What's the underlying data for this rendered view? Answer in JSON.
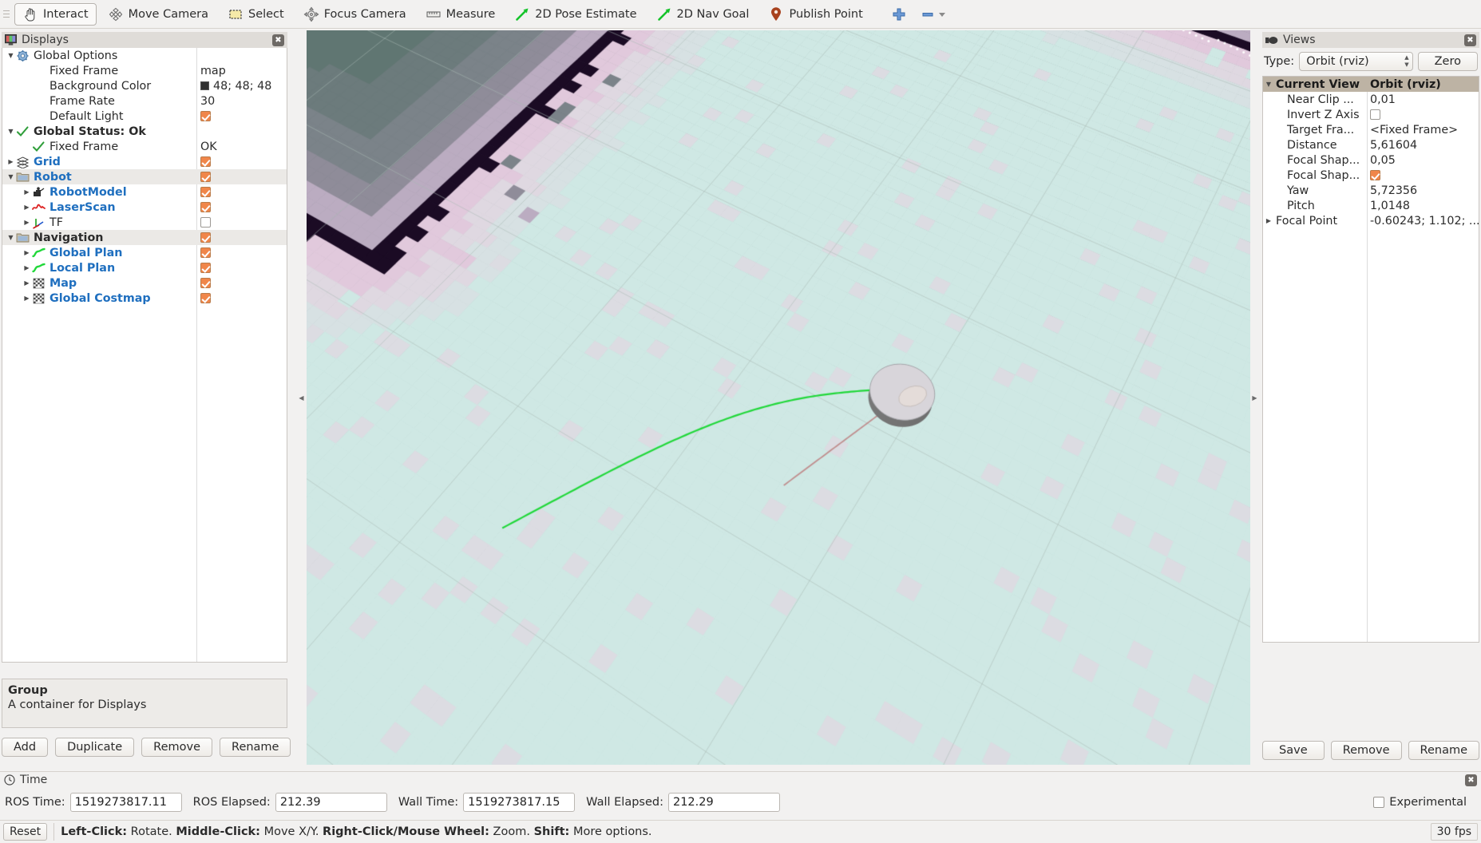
{
  "toolbar": {
    "items": [
      {
        "label": "Interact",
        "icon": "hand-cursor-icon",
        "active": true
      },
      {
        "label": "Move Camera",
        "icon": "move-camera-icon",
        "active": false
      },
      {
        "label": "Select",
        "icon": "select-rectangle-icon",
        "active": false
      },
      {
        "label": "Focus Camera",
        "icon": "focus-camera-icon",
        "active": false
      },
      {
        "label": "Measure",
        "icon": "ruler-icon",
        "active": false
      },
      {
        "label": "2D Pose Estimate",
        "icon": "green-arrow-icon",
        "active": false
      },
      {
        "label": "2D Nav Goal",
        "icon": "green-arrow-icon",
        "active": false
      },
      {
        "label": "Publish Point",
        "icon": "map-pin-icon",
        "active": false
      }
    ],
    "add_tool_icon": "plus-icon",
    "remove_tool_icon": "minus-icon",
    "remove_tool_caret": "chevron-down-icon"
  },
  "displays": {
    "title": "Displays",
    "close_icon": "close-icon",
    "panel_icon": "display-monitor-icon",
    "rows": [
      {
        "indent": 0,
        "arrow": "down",
        "icon": "gear-icon",
        "label": "Global Options",
        "style": "plain",
        "value_type": "none"
      },
      {
        "indent": 1,
        "arrow": "none",
        "icon": "none",
        "label": "Fixed Frame",
        "style": "plain",
        "value_type": "text",
        "value": "map"
      },
      {
        "indent": 1,
        "arrow": "none",
        "icon": "none",
        "label": "Background Color",
        "style": "plain",
        "value_type": "color",
        "value": "48; 48; 48",
        "color": "#303030"
      },
      {
        "indent": 1,
        "arrow": "none",
        "icon": "none",
        "label": "Frame Rate",
        "style": "plain",
        "value_type": "text",
        "value": "30"
      },
      {
        "indent": 1,
        "arrow": "none",
        "icon": "none",
        "label": "Default Light",
        "style": "plain",
        "value_type": "check",
        "checked": true
      },
      {
        "indent": 0,
        "arrow": "down",
        "icon": "check-icon",
        "label": "Global Status: Ok",
        "style": "bold",
        "value_type": "none"
      },
      {
        "indent": 1,
        "arrow": "none",
        "icon": "check-icon",
        "label": "Fixed Frame",
        "style": "plain",
        "value_type": "text",
        "value": "OK"
      },
      {
        "indent": 0,
        "arrow": "right",
        "icon": "grid-icon",
        "label": "Grid",
        "style": "blue",
        "value_type": "check",
        "checked": true
      },
      {
        "indent": 0,
        "arrow": "down",
        "icon": "folder-icon",
        "label": "Robot",
        "style": "blue",
        "value_type": "check",
        "checked": true,
        "group": true
      },
      {
        "indent": 1,
        "arrow": "right",
        "icon": "robot-icon",
        "label": "RobotModel",
        "style": "blue",
        "value_type": "check",
        "checked": true
      },
      {
        "indent": 1,
        "arrow": "right",
        "icon": "laserscan-icon",
        "label": "LaserScan",
        "style": "blue",
        "value_type": "check",
        "checked": true
      },
      {
        "indent": 1,
        "arrow": "right",
        "icon": "tf-axes-icon",
        "label": "TF",
        "style": "plain",
        "value_type": "check",
        "checked": false
      },
      {
        "indent": 0,
        "arrow": "down",
        "icon": "folder-icon",
        "label": "Navigation",
        "style": "bold",
        "value_type": "check",
        "checked": true,
        "group": true
      },
      {
        "indent": 1,
        "arrow": "right",
        "icon": "path-icon",
        "label": "Global Plan",
        "style": "blue",
        "value_type": "check",
        "checked": true
      },
      {
        "indent": 1,
        "arrow": "right",
        "icon": "path-icon",
        "label": "Local Plan",
        "style": "blue",
        "value_type": "check",
        "checked": true
      },
      {
        "indent": 1,
        "arrow": "right",
        "icon": "map-grid-icon",
        "label": "Map",
        "style": "blue",
        "value_type": "check",
        "checked": true
      },
      {
        "indent": 1,
        "arrow": "right",
        "icon": "map-grid-icon",
        "label": "Global Costmap",
        "style": "blue",
        "value_type": "check",
        "checked": true
      }
    ],
    "description": {
      "title": "Group",
      "text": "A container for Displays"
    },
    "buttons": [
      "Add",
      "Duplicate",
      "Remove",
      "Rename"
    ]
  },
  "views": {
    "title": "Views",
    "panel_icon": "camera-icon",
    "close_icon": "close-icon",
    "type_label": "Type:",
    "type_value": "Orbit (rviz)",
    "zero_button": "Zero",
    "header": {
      "name": "Current View",
      "value": "Orbit (rviz)"
    },
    "rows": [
      {
        "label": "Near Clip ...",
        "value_type": "text",
        "value": "0,01"
      },
      {
        "label": "Invert Z Axis",
        "value_type": "check",
        "checked": false
      },
      {
        "label": "Target Fra...",
        "value_type": "text",
        "value": "<Fixed Frame>"
      },
      {
        "label": "Distance",
        "value_type": "text",
        "value": "5,61604"
      },
      {
        "label": "Focal Shap...",
        "value_type": "text",
        "value": "0,05"
      },
      {
        "label": "Focal Shap...",
        "value_type": "check",
        "checked": true
      },
      {
        "label": "Yaw",
        "value_type": "text",
        "value": "5,72356"
      },
      {
        "label": "Pitch",
        "value_type": "text",
        "value": "1,0148"
      },
      {
        "label": "Focal Point",
        "value_type": "text",
        "value": "-0.60243; 1.102; ...",
        "arrow": "right"
      }
    ],
    "buttons": [
      "Save",
      "Remove",
      "Rename"
    ]
  },
  "time": {
    "title": "Time",
    "panel_icon": "clock-icon",
    "close_icon": "close-icon",
    "fields": [
      {
        "label": "ROS Time:",
        "value": "1519273817.11"
      },
      {
        "label": "ROS Elapsed:",
        "value": "212.39"
      },
      {
        "label": "Wall Time:",
        "value": "1519273817.15"
      },
      {
        "label": "Wall Elapsed:",
        "value": "212.29"
      }
    ],
    "experimental_label": "Experimental",
    "experimental_checked": false
  },
  "statusbar": {
    "reset_button": "Reset",
    "hint_parts": [
      {
        "text": "Left-Click:",
        "bold": true
      },
      {
        "text": " Rotate. ",
        "bold": false
      },
      {
        "text": "Middle-Click:",
        "bold": true
      },
      {
        "text": " Move X/Y. ",
        "bold": false
      },
      {
        "text": "Right-Click/Mouse Wheel:",
        "bold": true
      },
      {
        "text": " Zoom. ",
        "bold": false
      },
      {
        "text": "Shift:",
        "bold": true
      },
      {
        "text": " More options.",
        "bold": false
      }
    ],
    "fps": "30 fps"
  },
  "viewport": {
    "background_color": "#607672",
    "free_space_color": "#cfe8e4",
    "obstacle_color": "#1b0b24",
    "inflation_near_color": "#e8cfe0",
    "inflation_mid_color": "#cbb6cf",
    "inflation_far_color": "#a898ae",
    "grid_line_color": "#8e9e99",
    "robot_body_color": "#d8d5da",
    "global_plan_color": "#21d83a",
    "local_plan_color": "#c08f8f",
    "laser_point_color": "#ffffff"
  }
}
